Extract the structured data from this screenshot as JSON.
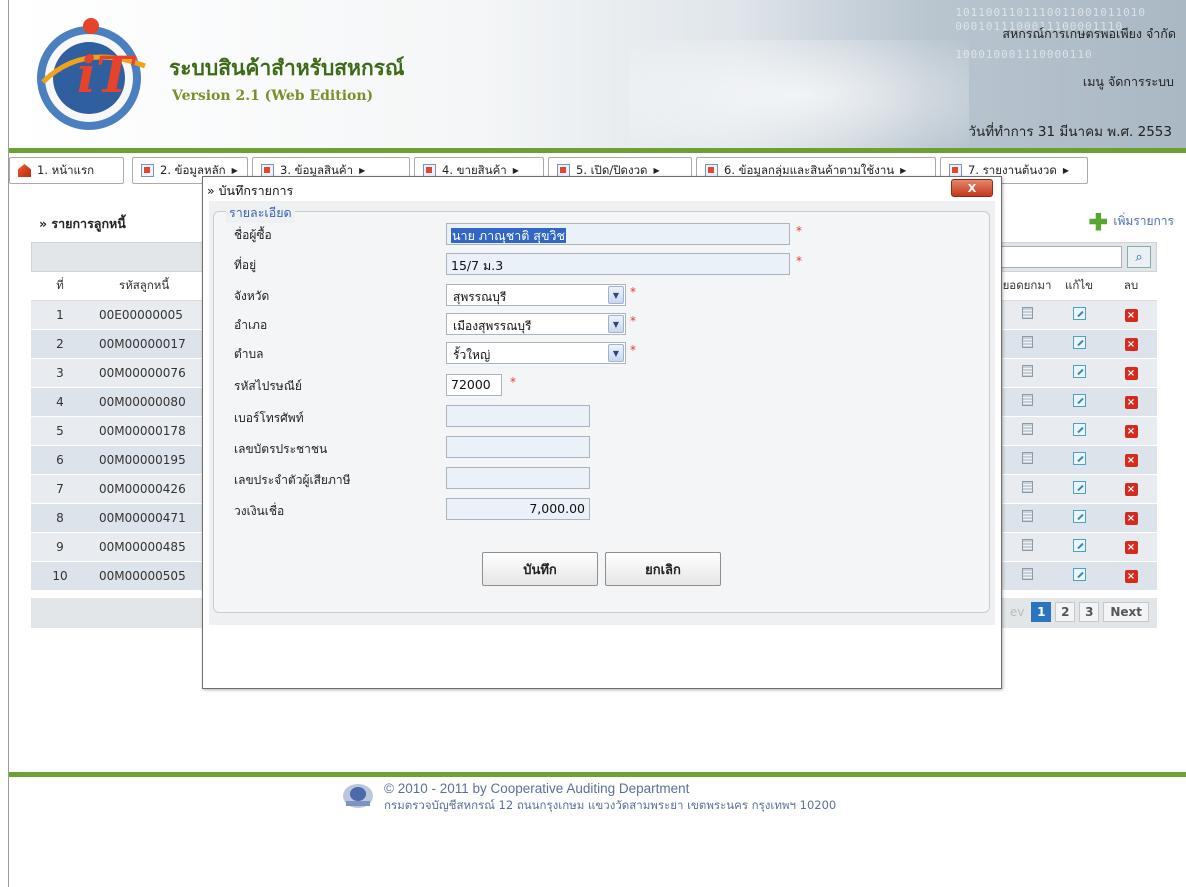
{
  "header": {
    "app_title": "ระบบสินค้าสำหรับสหกรณ์",
    "app_version": "Version 2.1 (Web Edition)",
    "coop_name": "สหกรณ์การเกษตรพอเพียง จำกัด",
    "menu_admin": "เมนู จัดการระบบ",
    "work_date": "วันที่ทำการ 31 มีนาคม พ.ศ. 2553",
    "logo_text": "iT",
    "binary_text": "1011001101110011001011010\n0001011100011100001110\n\n100010001110000110"
  },
  "menu": [
    {
      "label": "1. หน้าแรก",
      "icon": "home-icon",
      "has_arrow": false
    },
    {
      "label": "2. ข้อมูลหลัก",
      "icon": "document-icon",
      "has_arrow": true
    },
    {
      "label": "3. ข้อมูลสินค้า",
      "icon": "document-icon",
      "has_arrow": true
    },
    {
      "label": "4. ขายสินค้า",
      "icon": "document-icon",
      "has_arrow": true
    },
    {
      "label": "5. เปิด/ปิดงวด",
      "icon": "document-icon",
      "has_arrow": true
    },
    {
      "label": "6. ข้อมูลกลุ่มและสินค้าตามใช้งาน",
      "icon": "document-icon",
      "has_arrow": true
    },
    {
      "label": "7. รายงานต้นงวด",
      "icon": "document-icon",
      "has_arrow": true
    }
  ],
  "panel": {
    "title": "» รายการลูกหนี้",
    "add_label": "เพิ่มรายการ",
    "search_icon": "search-icon",
    "columns": {
      "no": "ที่",
      "code": "รหัสลูกหนี้",
      "view": "ยอดยกมา",
      "edit": "แก้ไข",
      "del": "ลบ"
    },
    "rows": [
      {
        "no": "1",
        "code": "00E00000005"
      },
      {
        "no": "2",
        "code": "00M00000017"
      },
      {
        "no": "3",
        "code": "00M00000076"
      },
      {
        "no": "4",
        "code": "00M00000080"
      },
      {
        "no": "5",
        "code": "00M00000178"
      },
      {
        "no": "6",
        "code": "00M00000195"
      },
      {
        "no": "7",
        "code": "00M00000426"
      },
      {
        "no": "8",
        "code": "00M00000471"
      },
      {
        "no": "9",
        "code": "00M00000485"
      },
      {
        "no": "10",
        "code": "00M00000505"
      }
    ],
    "pager": {
      "prev": "ev",
      "pages": [
        "1",
        "2",
        "3"
      ],
      "active_page": "1",
      "next": "Next"
    }
  },
  "modal": {
    "title": "» บันทึกรายการ",
    "close_label": "X",
    "legend": "รายละเอียด",
    "fields": {
      "buyer_name": {
        "label": "ชื่อผู้ซื้อ",
        "value": "นาย ภาณุชาติ  สุขวิช",
        "required": "*"
      },
      "address": {
        "label": "ที่อยู่",
        "value": "15/7 ม.3",
        "required": "*"
      },
      "province": {
        "label": "จังหวัด",
        "value": "สุพรรณบุรี",
        "required": "*"
      },
      "district": {
        "label": "อำเภอ",
        "value": "เมืองสุพรรณบุรี",
        "required": "*"
      },
      "subdistrict": {
        "label": "ตำบล",
        "value": "รั้วใหญ่",
        "required": "*"
      },
      "postcode": {
        "label": "รหัสไปรษณีย์",
        "value": "72000",
        "required": "*"
      },
      "phone": {
        "label": "เบอร์โทรศัพท์",
        "value": ""
      },
      "id_card": {
        "label": "เลขบัตรประชาชน",
        "value": ""
      },
      "tax_id": {
        "label": "เลขประจำตัวผู้เสียภาษี",
        "value": ""
      },
      "credit_limit": {
        "label": "วงเงินเชื่อ",
        "value": "7,000.00"
      }
    },
    "save_label": "บันทึก",
    "cancel_label": "ยกเลิก"
  },
  "footer": {
    "copyright": "© 2010 - 2011  by Cooperative Auditing Department",
    "address": "กรมตรวจบัญชีสหกรณ์ 12 ถนนกรุงเกษม แขวงวัดสามพระยา เขตพระนคร กรุงเทพฯ 10200"
  },
  "colors": {
    "accent_green": "#6aa132",
    "title_green": "#3c6b18",
    "link_blue": "#3a64b8",
    "required_red": "#e0402a",
    "pager_active": "#2a75bd"
  }
}
